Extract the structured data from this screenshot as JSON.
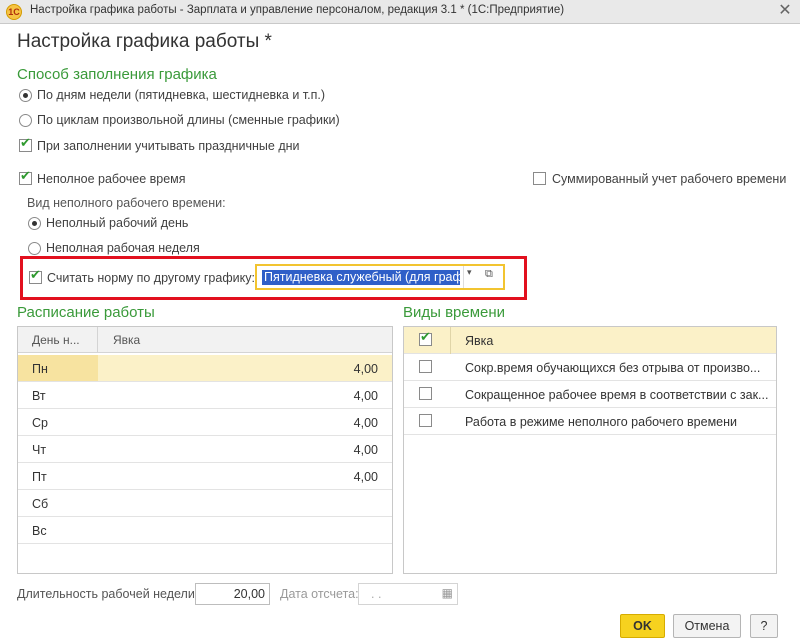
{
  "window": {
    "title": "Настройка графика работы - Зарплата и управление персоналом, редакция 3.1 * (1С:Предприятие)",
    "app_icon": "1С",
    "close_glyph": "✕"
  },
  "page_title": "Настройка графика работы *",
  "fill_method": {
    "heading": "Способ заполнения графика",
    "option_weekdays": "По дням недели (пятидневка, шестидневка и т.п.)",
    "option_cycles": "По циклам произвольной длины (сменные графики)",
    "holidays_checkbox": "При заполнении учитывать праздничные дни"
  },
  "part_time": {
    "checkbox": "Неполное рабочее время",
    "summarized_checkbox": "Суммированный учет рабочего времени",
    "kind_label": "Вид неполного рабочего времени:",
    "option_day": "Неполный рабочий день",
    "option_week": "Неполная рабочая неделя",
    "norm_checkbox": "Считать норму по другому графику:",
    "norm_schedule_value": "Пятидневка служебный (для графи",
    "dropdown_glyph": "▾",
    "open_glyph": "⧉"
  },
  "schedule": {
    "heading": "Расписание работы",
    "col_day": "День н...",
    "col_attendance": "Явка",
    "rows": [
      {
        "day": "Пн",
        "hours": "4,00"
      },
      {
        "day": "Вт",
        "hours": "4,00"
      },
      {
        "day": "Ср",
        "hours": "4,00"
      },
      {
        "day": "Чт",
        "hours": "4,00"
      },
      {
        "day": "Пт",
        "hours": "4,00"
      },
      {
        "day": "Сб",
        "hours": ""
      },
      {
        "day": "Вс",
        "hours": ""
      }
    ]
  },
  "time_types": {
    "heading": "Виды времени",
    "rows": [
      {
        "label": "Явка",
        "checked": true
      },
      {
        "label": "Сокр.время обучающихся без отрыва от произво...",
        "checked": false
      },
      {
        "label": "Сокращенное рабочее время в соответствии с зак...",
        "checked": false
      },
      {
        "label": "Работа в режиме неполного рабочего времени",
        "checked": false
      }
    ]
  },
  "footer": {
    "week_length_label": "Длительность рабочей недели:",
    "week_length_value": "20,00",
    "ref_date_label": "Дата отсчета:",
    "ref_date_value": ". .",
    "calendar_glyph": "▦",
    "ok_button": "OK",
    "cancel_button": "Отмена",
    "help_button": "?"
  },
  "colors": {
    "accent_green": "#3a9a3a",
    "highlight_red": "#e2101e",
    "ok_yellow": "#f6d21f",
    "selected_row": "#fbf1c8"
  }
}
